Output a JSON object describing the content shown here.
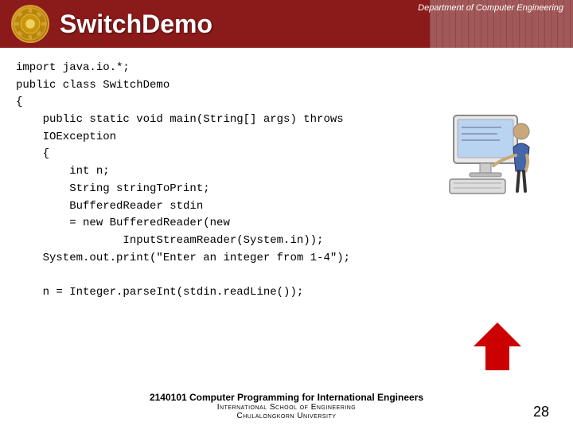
{
  "header": {
    "dept_label": "Department of Computer Engineering",
    "title": "SwitchDemo"
  },
  "code": {
    "lines": [
      "import java.io.*;",
      "public class SwitchDemo",
      "{",
      "    public static void main(String[] args) throws",
      "    IOException",
      "    {",
      "        int n;",
      "        String stringToPrint;",
      "        BufferedReader stdin",
      "        = new BufferedReader(new",
      "                InputStreamReader(System.in));",
      "    System.out.print(\"Enter an integer from 1-4\");",
      "",
      "    n = Integer.parseInt(stdin.readLine());",
      ""
    ]
  },
  "footer": {
    "line1": "2140101 Computer Programming for International Engineers",
    "line2": "International School of Engineering",
    "line3": "Chulalongkorn University",
    "page": "28"
  }
}
